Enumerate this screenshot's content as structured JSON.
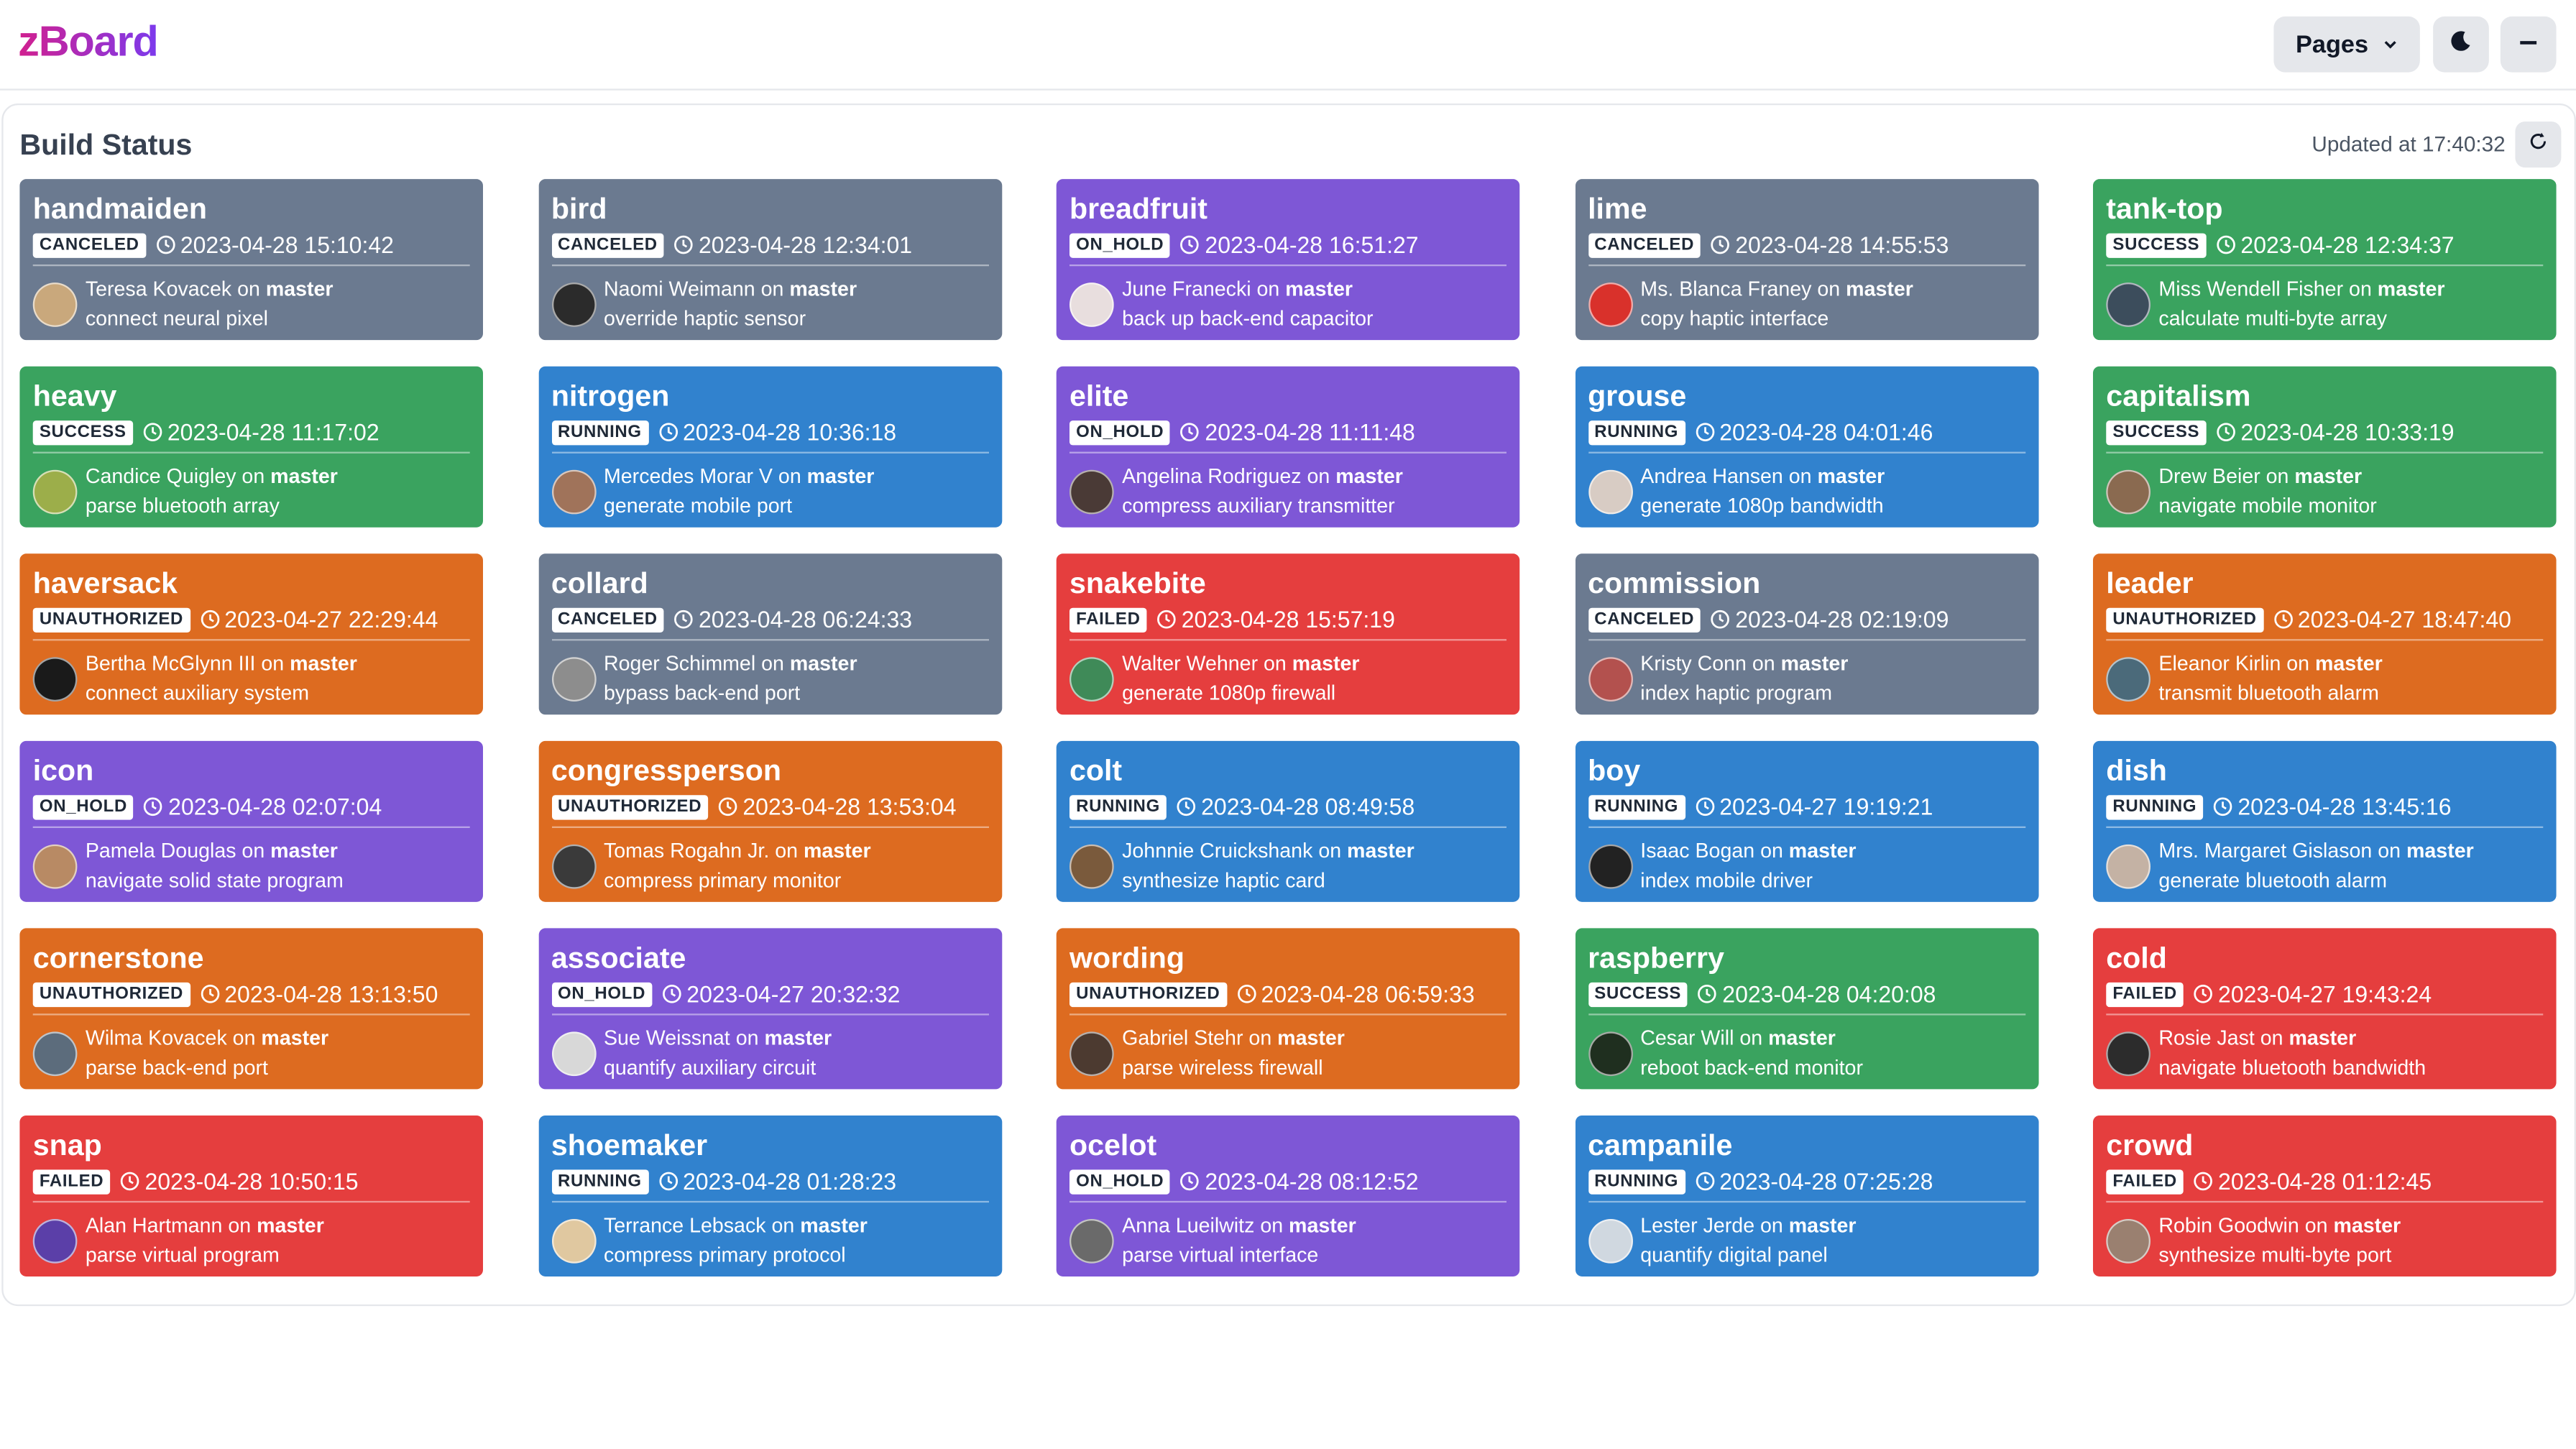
{
  "header": {
    "logo": "zBoard",
    "pages_label": "Pages"
  },
  "panel": {
    "title": "Build Status",
    "updated": "Updated at 17:40:32"
  },
  "builds": [
    {
      "name": "handmaiden",
      "status": "CANCELED",
      "time": "2023-04-28 15:10:42",
      "author": "Teresa Kovacek",
      "on": " on ",
      "branch": "master",
      "message": "connect neural pixel",
      "avatar": "#c9a87c"
    },
    {
      "name": "bird",
      "status": "CANCELED",
      "time": "2023-04-28 12:34:01",
      "author": "Naomi Weimann",
      "on": " on ",
      "branch": "master",
      "message": "override haptic sensor",
      "avatar": "#2b2b2b"
    },
    {
      "name": "breadfruit",
      "status": "ON_HOLD",
      "time": "2023-04-28 16:51:27",
      "author": "June Franecki",
      "on": " on ",
      "branch": "master",
      "message": "back up back-end capacitor",
      "avatar": "#e8dede"
    },
    {
      "name": "lime",
      "status": "CANCELED",
      "time": "2023-04-28 14:55:53",
      "author": "Ms. Blanca Franey",
      "on": " on ",
      "branch": "master",
      "message": "copy haptic interface",
      "avatar": "#d9312b"
    },
    {
      "name": "tank-top",
      "status": "SUCCESS",
      "time": "2023-04-28 12:34:37",
      "author": "Miss Wendell Fisher",
      "on": " on ",
      "branch": "master",
      "message": "calculate multi-byte array",
      "avatar": "#3c4d5c"
    },
    {
      "name": "heavy",
      "status": "SUCCESS",
      "time": "2023-04-28 11:17:02",
      "author": "Candice Quigley",
      "on": " on ",
      "branch": "master",
      "message": "parse bluetooth array",
      "avatar": "#9cae4a"
    },
    {
      "name": "nitrogen",
      "status": "RUNNING",
      "time": "2023-04-28 10:36:18",
      "author": "Mercedes Morar V",
      "on": " on ",
      "branch": "master",
      "message": "generate mobile port",
      "avatar": "#a0735a"
    },
    {
      "name": "elite",
      "status": "ON_HOLD",
      "time": "2023-04-28 11:11:48",
      "author": "Angelina Rodriguez",
      "on": " on ",
      "branch": "master",
      "message": "compress auxiliary transmitter",
      "avatar": "#4a3a36"
    },
    {
      "name": "grouse",
      "status": "RUNNING",
      "time": "2023-04-28 04:01:46",
      "author": "Andrea Hansen",
      "on": " on ",
      "branch": "master",
      "message": "generate 1080p bandwidth",
      "avatar": "#d8ccc4"
    },
    {
      "name": "capitalism",
      "status": "SUCCESS",
      "time": "2023-04-28 10:33:19",
      "author": "Drew Beier",
      "on": " on ",
      "branch": "master",
      "message": "navigate mobile monitor",
      "avatar": "#8a6a50"
    },
    {
      "name": "haversack",
      "status": "UNAUTHORIZED",
      "time": "2023-04-27 22:29:44",
      "author": "Bertha McGlynn III",
      "on": " on ",
      "branch": "master",
      "message": "connect auxiliary system",
      "avatar": "#1a1a1a"
    },
    {
      "name": "collard",
      "status": "CANCELED",
      "time": "2023-04-28 06:24:33",
      "author": "Roger Schimmel",
      "on": " on ",
      "branch": "master",
      "message": "bypass back-end port",
      "avatar": "#8d8d8d"
    },
    {
      "name": "snakebite",
      "status": "FAILED",
      "time": "2023-04-28 15:57:19",
      "author": "Walter Wehner",
      "on": " on ",
      "branch": "master",
      "message": "generate 1080p firewall",
      "avatar": "#3f8a58"
    },
    {
      "name": "commission",
      "status": "CANCELED",
      "time": "2023-04-28 02:19:09",
      "author": "Kristy Conn",
      "on": " on ",
      "branch": "master",
      "message": "index haptic program",
      "avatar": "#b3514e"
    },
    {
      "name": "leader",
      "status": "UNAUTHORIZED",
      "time": "2023-04-27 18:47:40",
      "author": "Eleanor Kirlin",
      "on": " on ",
      "branch": "master",
      "message": "transmit bluetooth alarm",
      "avatar": "#4b6a7a"
    },
    {
      "name": "icon",
      "status": "ON_HOLD",
      "time": "2023-04-28 02:07:04",
      "author": "Pamela Douglas",
      "on": " on ",
      "branch": "master",
      "message": "navigate solid state program",
      "avatar": "#b88a64"
    },
    {
      "name": "congressperson",
      "status": "UNAUTHORIZED",
      "time": "2023-04-28 13:53:04",
      "author": "Tomas Rogahn Jr.",
      "on": " on ",
      "branch": "master",
      "message": "compress primary monitor",
      "avatar": "#3a3a3a"
    },
    {
      "name": "colt",
      "status": "RUNNING",
      "time": "2023-04-28 08:49:58",
      "author": "Johnnie Cruickshank",
      "on": " on ",
      "branch": "master",
      "message": "synthesize haptic card",
      "avatar": "#7a5a3c"
    },
    {
      "name": "boy",
      "status": "RUNNING",
      "time": "2023-04-27 19:19:21",
      "author": "Isaac Bogan",
      "on": " on ",
      "branch": "master",
      "message": "index mobile driver",
      "avatar": "#222222"
    },
    {
      "name": "dish",
      "status": "RUNNING",
      "time": "2023-04-28 13:45:16",
      "author": "Mrs. Margaret Gislason",
      "on": " on ",
      "branch": "master",
      "message": "generate bluetooth alarm",
      "avatar": "#c4b2a4"
    },
    {
      "name": "cornerstone",
      "status": "UNAUTHORIZED",
      "time": "2023-04-28 13:13:50",
      "author": "Wilma Kovacek",
      "on": " on ",
      "branch": "master",
      "message": "parse back-end port",
      "avatar": "#5c6c7c"
    },
    {
      "name": "associate",
      "status": "ON_HOLD",
      "time": "2023-04-27 20:32:32",
      "author": "Sue Weissnat",
      "on": " on ",
      "branch": "master",
      "message": "quantify auxiliary circuit",
      "avatar": "#d8d8d8"
    },
    {
      "name": "wording",
      "status": "UNAUTHORIZED",
      "time": "2023-04-28 06:59:33",
      "author": "Gabriel Stehr",
      "on": " on ",
      "branch": "master",
      "message": "parse wireless firewall",
      "avatar": "#4c3a30"
    },
    {
      "name": "raspberry",
      "status": "SUCCESS",
      "time": "2023-04-28 04:20:08",
      "author": "Cesar Will",
      "on": " on ",
      "branch": "master",
      "message": "reboot back-end monitor",
      "avatar": "#1f2f1f"
    },
    {
      "name": "cold",
      "status": "FAILED",
      "time": "2023-04-27 19:43:24",
      "author": "Rosie Jast",
      "on": " on ",
      "branch": "master",
      "message": "navigate bluetooth bandwidth",
      "avatar": "#2c2c2c"
    },
    {
      "name": "snap",
      "status": "FAILED",
      "time": "2023-04-28 10:50:15",
      "author": "Alan Hartmann",
      "on": " on ",
      "branch": "master",
      "message": "parse virtual program",
      "avatar": "#5b3fa8"
    },
    {
      "name": "shoemaker",
      "status": "RUNNING",
      "time": "2023-04-28 01:28:23",
      "author": "Terrance Lebsack",
      "on": " on ",
      "branch": "master",
      "message": "compress primary protocol",
      "avatar": "#e0c8a0"
    },
    {
      "name": "ocelot",
      "status": "ON_HOLD",
      "time": "2023-04-28 08:12:52",
      "author": "Anna Lueilwitz",
      "on": " on ",
      "branch": "master",
      "message": "parse virtual interface",
      "avatar": "#6a6a6a"
    },
    {
      "name": "campanile",
      "status": "RUNNING",
      "time": "2023-04-28 07:25:28",
      "author": "Lester Jerde",
      "on": " on ",
      "branch": "master",
      "message": "quantify digital panel",
      "avatar": "#d0d8e0"
    },
    {
      "name": "crowd",
      "status": "FAILED",
      "time": "2023-04-28 01:12:45",
      "author": "Robin Goodwin",
      "on": " on ",
      "branch": "master",
      "message": "synthesize multi-byte port",
      "avatar": "#9a8070"
    }
  ],
  "status_colors": {
    "CANCELED": "#6b7a90",
    "ON_HOLD": "#7e57d6",
    "SUCCESS": "#3aa35f",
    "RUNNING": "#3182ce",
    "UNAUTHORIZED": "#dd6b20",
    "FAILED": "#e53e3e"
  },
  "icons": {
    "pages_caret": "chevron-down-icon",
    "theme": "moon-icon",
    "minimize": "minus-icon",
    "refresh": "refresh-icon",
    "time": "clock-icon"
  }
}
